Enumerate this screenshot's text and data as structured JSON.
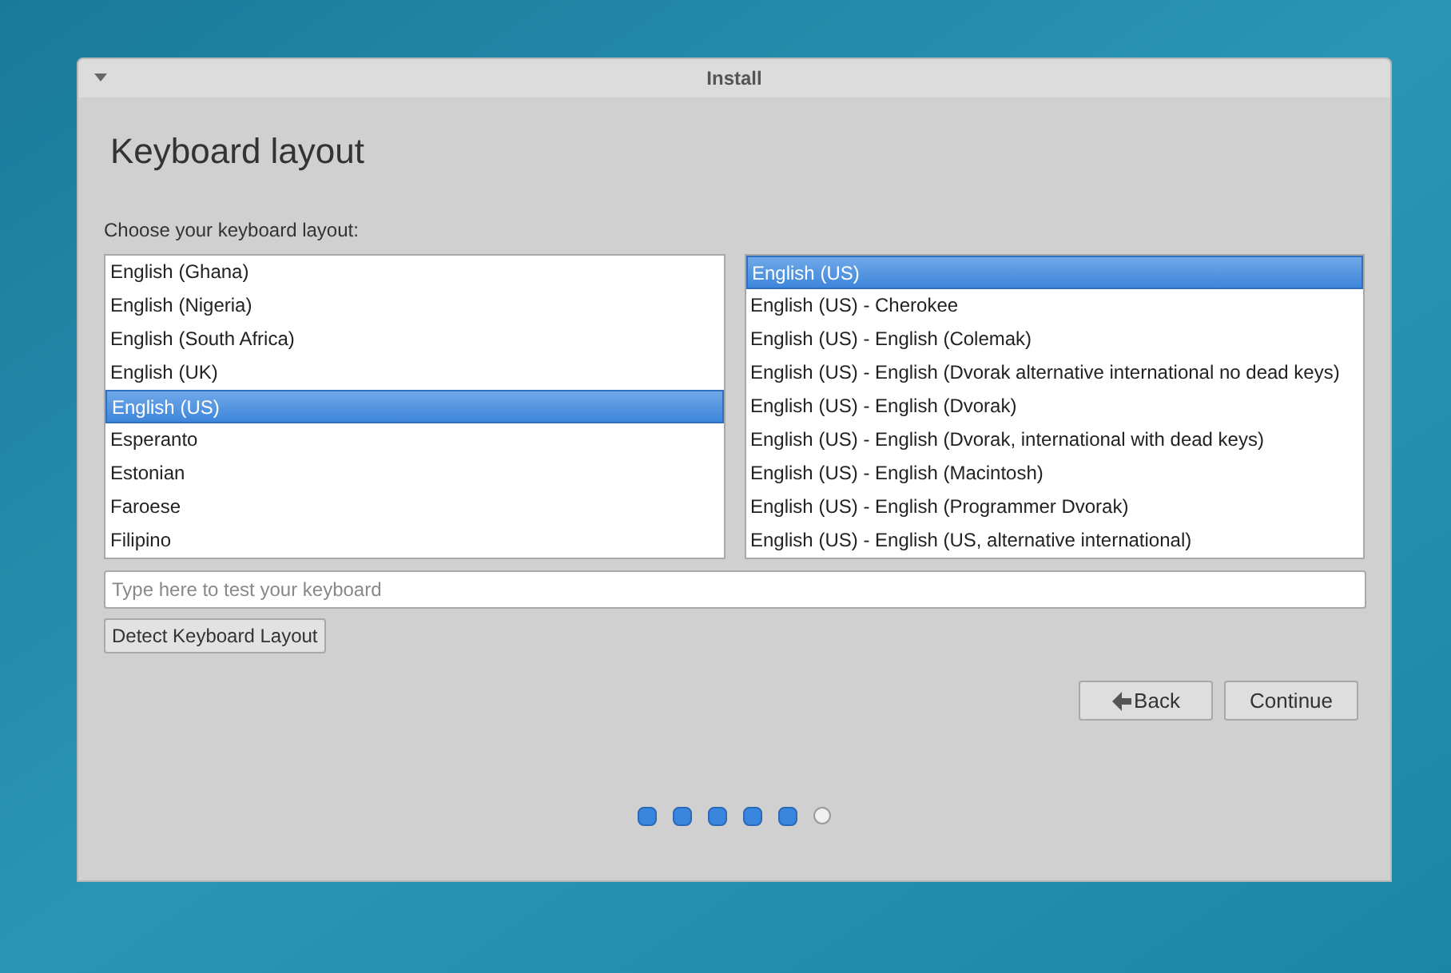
{
  "window": {
    "title": "Install"
  },
  "heading": "Keyboard layout",
  "prompt": "Choose your keyboard layout:",
  "layouts": [
    {
      "label": "English (Ghana)",
      "selected": false
    },
    {
      "label": "English (Nigeria)",
      "selected": false
    },
    {
      "label": "English (South Africa)",
      "selected": false
    },
    {
      "label": "English (UK)",
      "selected": false
    },
    {
      "label": "English (US)",
      "selected": true
    },
    {
      "label": "Esperanto",
      "selected": false
    },
    {
      "label": "Estonian",
      "selected": false
    },
    {
      "label": "Faroese",
      "selected": false
    },
    {
      "label": "Filipino",
      "selected": false
    }
  ],
  "variants": [
    {
      "label": "English (US)",
      "selected": true
    },
    {
      "label": "English (US) - Cherokee",
      "selected": false
    },
    {
      "label": "English (US) - English (Colemak)",
      "selected": false
    },
    {
      "label": "English (US) - English (Dvorak alternative international no dead keys)",
      "selected": false
    },
    {
      "label": "English (US) - English (Dvorak)",
      "selected": false
    },
    {
      "label": "English (US) - English (Dvorak, international with dead keys)",
      "selected": false
    },
    {
      "label": "English (US) - English (Macintosh)",
      "selected": false
    },
    {
      "label": "English (US) - English (Programmer Dvorak)",
      "selected": false
    },
    {
      "label": "English (US) - English (US, alternative international)",
      "selected": false
    }
  ],
  "test_field": {
    "placeholder": "Type here to test your keyboard"
  },
  "detect_button": "Detect Keyboard Layout",
  "back_button": "Back",
  "continue_button": "Continue",
  "steps": [
    {
      "done": true
    },
    {
      "done": true
    },
    {
      "done": true
    },
    {
      "done": true
    },
    {
      "done": true
    },
    {
      "done": false
    }
  ]
}
